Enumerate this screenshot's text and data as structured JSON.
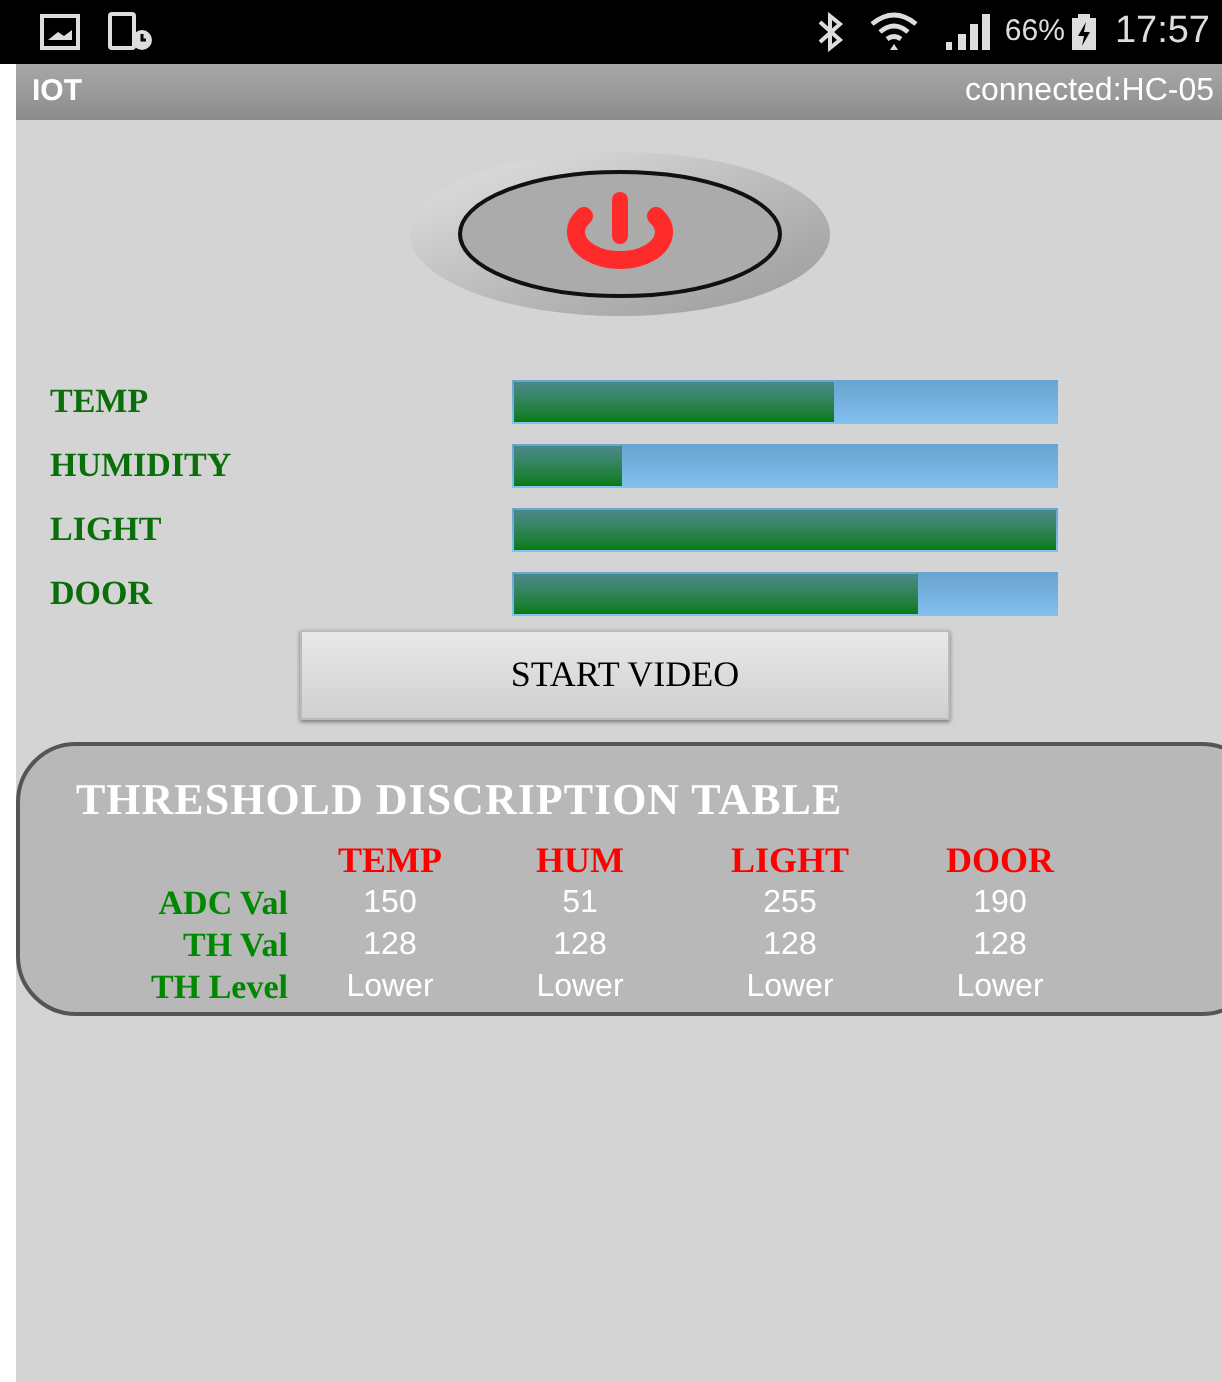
{
  "status_bar": {
    "battery": "66%",
    "time": "17:57"
  },
  "app_bar": {
    "title": "IOT",
    "status": "connected:HC-05"
  },
  "sensors": [
    {
      "label": "TEMP",
      "level": 0.59
    },
    {
      "label": "HUMIDITY",
      "level": 0.2
    },
    {
      "label": "LIGHT",
      "level": 1
    },
    {
      "label": "DOOR",
      "level": 0.745
    }
  ],
  "video_button": "START VIDEO",
  "table": {
    "title": "THRESHOLD DISCRIPTION TABLE",
    "columns": [
      "TEMP",
      "HUM",
      "LIGHT",
      "DOOR"
    ],
    "rows": [
      {
        "label": "ADC Val",
        "cells": [
          "150",
          "51",
          "255",
          "190"
        ]
      },
      {
        "label": "TH Val",
        "cells": [
          "128",
          "128",
          "128",
          "128"
        ]
      },
      {
        "label": "TH Level",
        "cells": [
          "Lower",
          "Lower",
          "Lower",
          "Lower"
        ]
      }
    ]
  }
}
